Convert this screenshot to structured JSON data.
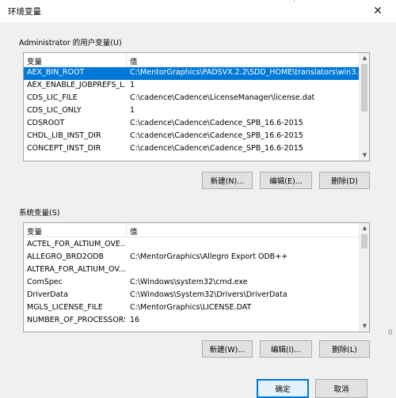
{
  "window": {
    "title": "环境变量",
    "close_icon": "✕"
  },
  "user_vars": {
    "label": "Administrator 的用户变量(U)",
    "columns": [
      "变量",
      "值"
    ],
    "rows": [
      {
        "name": "AEX_BIN_ROOT",
        "value": "C:\\MentorGraphics\\PADSVX.2.2\\SDD_HOME\\translators\\win3...",
        "selected": true
      },
      {
        "name": "AEX_ENABLE_JOBPREFS_L...",
        "value": "1"
      },
      {
        "name": "CDS_LIC_FILE",
        "value": "C:\\cadence\\Cadence\\LicenseManager\\license.dat"
      },
      {
        "name": "CDS_LIC_ONLY",
        "value": "1"
      },
      {
        "name": "CDSROOT",
        "value": "C:\\cadence\\Cadence\\Cadence_SPB_16.6-2015"
      },
      {
        "name": "CHDL_LIB_INST_DIR",
        "value": "C:\\cadence\\Cadence\\Cadence_SPB_16.6-2015"
      },
      {
        "name": "CONCEPT_INST_DIR",
        "value": "C:\\cadence\\Cadence\\Cadence_SPB_16.6-2015"
      }
    ],
    "buttons": {
      "new": "新建(N)...",
      "edit": "编辑(E)...",
      "delete": "删除(D)"
    }
  },
  "system_vars": {
    "label": "系统变量(S)",
    "columns": [
      "变量",
      "值"
    ],
    "rows": [
      {
        "name": "ACTEL_FOR_ALTIUM_OVE...",
        "value": ""
      },
      {
        "name": "ALLEGRO_BRD2ODB",
        "value": "C:\\MentorGraphics\\Allegro Export ODB++"
      },
      {
        "name": "ALTERA_FOR_ALTIUM_OV...",
        "value": ""
      },
      {
        "name": "ComSpec",
        "value": "C:\\Windows\\system32\\cmd.exe"
      },
      {
        "name": "DriverData",
        "value": "C:\\Windows\\System32\\Drivers\\DriverData"
      },
      {
        "name": "MGLS_LICENSE_FILE",
        "value": "C:\\MentorGraphics\\LICENSE.DAT"
      },
      {
        "name": "NUMBER_OF_PROCESSORS",
        "value": "16"
      }
    ],
    "buttons": {
      "new": "新建(W)...",
      "edit": "编辑(I)...",
      "delete": "删除(L)"
    }
  },
  "footer": {
    "ok": "确定",
    "cancel": "取消"
  },
  "edge_char": "0",
  "colors": {
    "selection": "#0078d7",
    "background": "#f0f0f0"
  }
}
